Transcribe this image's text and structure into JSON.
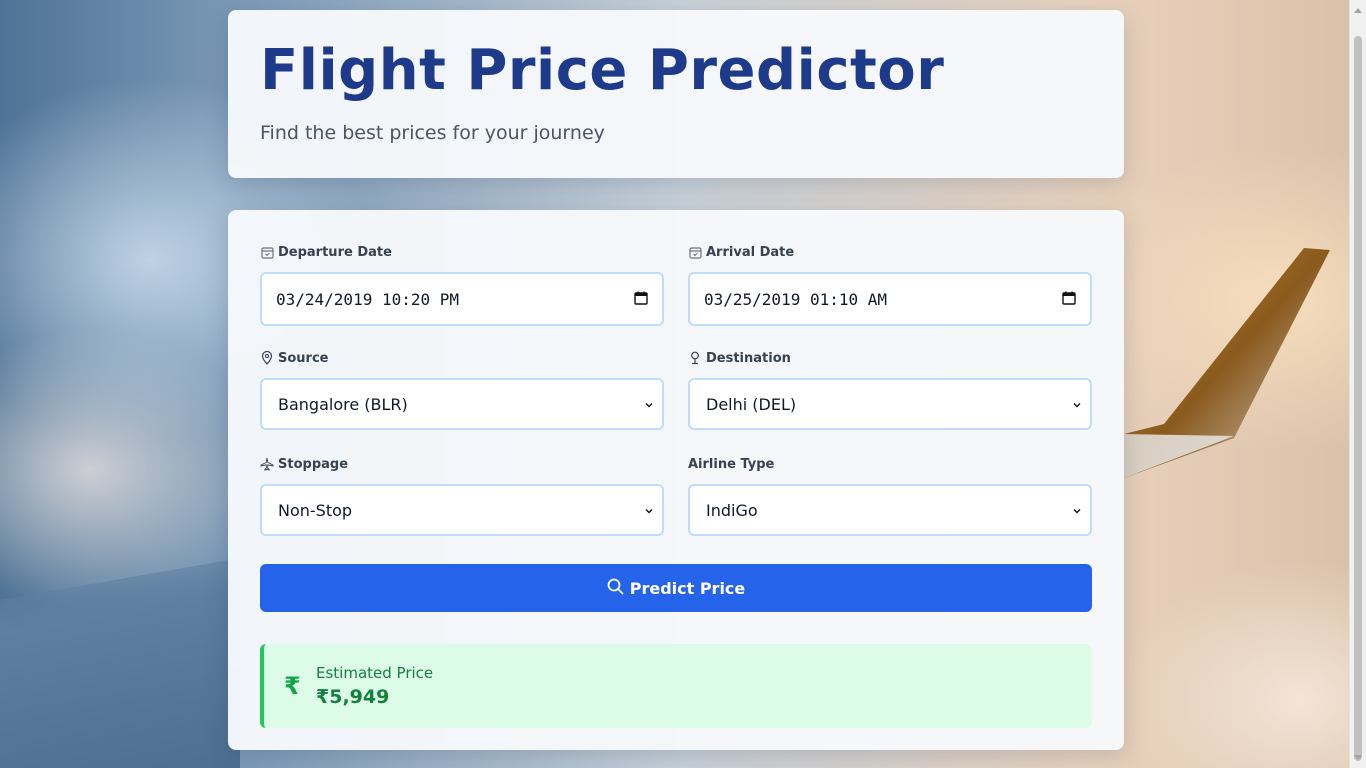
{
  "header": {
    "title": "Flight Price Predictor",
    "subtitle": "Find the best prices for your journey"
  },
  "form": {
    "departure": {
      "label": "Departure Date",
      "value": "03/24/2019 10:20 PM",
      "icon": "calendar-icon"
    },
    "arrival": {
      "label": "Arrival Date",
      "value": "03/25/2019 01:10 AM",
      "icon": "calendar-icon"
    },
    "source": {
      "label": "Source",
      "value": "Bangalore (BLR)",
      "icon": "map-pin-icon"
    },
    "destination": {
      "label": "Destination",
      "value": "Delhi (DEL)",
      "icon": "location-marker-icon"
    },
    "stoppage": {
      "label": "Stoppage",
      "value": "Non-Stop",
      "icon": "plane-icon"
    },
    "airline": {
      "label": "Airline Type",
      "value": "IndiGo"
    },
    "predict_button": "Predict Price"
  },
  "result": {
    "symbol": "₹",
    "label": "Estimated Price",
    "price": "₹5,949"
  },
  "colors": {
    "title": "#1e3a8a",
    "button": "#2563eb",
    "result_bg": "#dcfce7",
    "result_accent": "#22c55e",
    "input_border": "#bfdbfe"
  }
}
